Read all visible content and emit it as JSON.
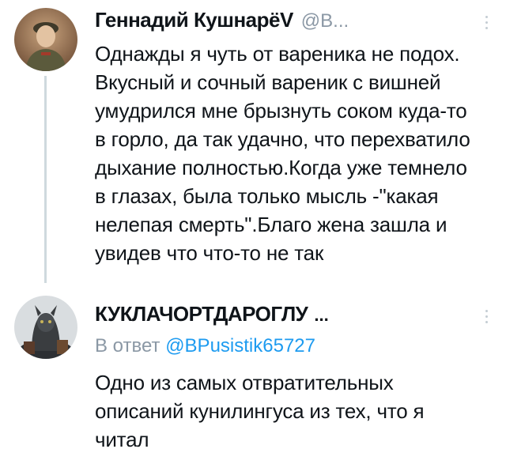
{
  "tweets": [
    {
      "author_name": "Геннадий КушнарёV",
      "handle": "@B...",
      "text": "Однажды я чуть от вареника не подох.\nВкусный и сочный вареник с вишней\nумудрился мне брызнуть соком куда-то\nв горло, да так удачно, что перехватило\nдыхание полностью.Когда уже темнело\nв глазах, была только мысль -\"какая\nнелепая смерть\".Благо жена зашла и\nувидев что что-то не так",
      "avatar_icon": "user-avatar-photo"
    },
    {
      "author_name": "КУКЛАЧОРТДАРОГЛУ",
      "ellipsis": "...",
      "reply_prefix": "В ответ",
      "reply_mention": "@BPusistik65727",
      "text": "Одно из самых отвратительных\nописаний кунилингуса из тех, что я\nчитал",
      "avatar_icon": "user-avatar-photo"
    }
  ],
  "icons": {
    "more_menu": "vertical-dots-icon"
  },
  "colors": {
    "text_primary": "#0f1419",
    "text_secondary": "#8b98a5",
    "link": "#1d9bf0",
    "thread_line": "#cfd9de"
  }
}
